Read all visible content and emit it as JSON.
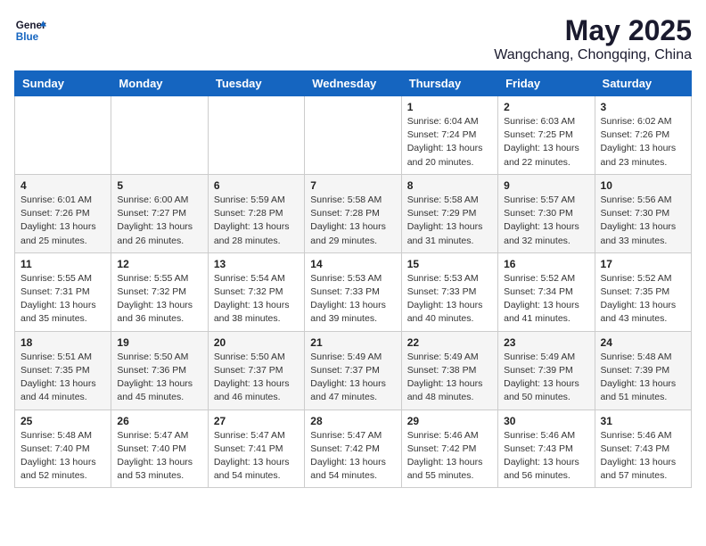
{
  "logo": {
    "general": "General",
    "blue": "Blue"
  },
  "title": "May 2025",
  "subtitle": "Wangchang, Chongqing, China",
  "days_of_week": [
    "Sunday",
    "Monday",
    "Tuesday",
    "Wednesday",
    "Thursday",
    "Friday",
    "Saturday"
  ],
  "weeks": [
    [
      {
        "day": "",
        "info": ""
      },
      {
        "day": "",
        "info": ""
      },
      {
        "day": "",
        "info": ""
      },
      {
        "day": "",
        "info": ""
      },
      {
        "day": "1",
        "sunrise": "6:04 AM",
        "sunset": "7:24 PM",
        "daylight": "13 hours and 20 minutes."
      },
      {
        "day": "2",
        "sunrise": "6:03 AM",
        "sunset": "7:25 PM",
        "daylight": "13 hours and 22 minutes."
      },
      {
        "day": "3",
        "sunrise": "6:02 AM",
        "sunset": "7:26 PM",
        "daylight": "13 hours and 23 minutes."
      }
    ],
    [
      {
        "day": "4",
        "sunrise": "6:01 AM",
        "sunset": "7:26 PM",
        "daylight": "13 hours and 25 minutes."
      },
      {
        "day": "5",
        "sunrise": "6:00 AM",
        "sunset": "7:27 PM",
        "daylight": "13 hours and 26 minutes."
      },
      {
        "day": "6",
        "sunrise": "5:59 AM",
        "sunset": "7:28 PM",
        "daylight": "13 hours and 28 minutes."
      },
      {
        "day": "7",
        "sunrise": "5:58 AM",
        "sunset": "7:28 PM",
        "daylight": "13 hours and 29 minutes."
      },
      {
        "day": "8",
        "sunrise": "5:58 AM",
        "sunset": "7:29 PM",
        "daylight": "13 hours and 31 minutes."
      },
      {
        "day": "9",
        "sunrise": "5:57 AM",
        "sunset": "7:30 PM",
        "daylight": "13 hours and 32 minutes."
      },
      {
        "day": "10",
        "sunrise": "5:56 AM",
        "sunset": "7:30 PM",
        "daylight": "13 hours and 33 minutes."
      }
    ],
    [
      {
        "day": "11",
        "sunrise": "5:55 AM",
        "sunset": "7:31 PM",
        "daylight": "13 hours and 35 minutes."
      },
      {
        "day": "12",
        "sunrise": "5:55 AM",
        "sunset": "7:32 PM",
        "daylight": "13 hours and 36 minutes."
      },
      {
        "day": "13",
        "sunrise": "5:54 AM",
        "sunset": "7:32 PM",
        "daylight": "13 hours and 38 minutes."
      },
      {
        "day": "14",
        "sunrise": "5:53 AM",
        "sunset": "7:33 PM",
        "daylight": "13 hours and 39 minutes."
      },
      {
        "day": "15",
        "sunrise": "5:53 AM",
        "sunset": "7:33 PM",
        "daylight": "13 hours and 40 minutes."
      },
      {
        "day": "16",
        "sunrise": "5:52 AM",
        "sunset": "7:34 PM",
        "daylight": "13 hours and 41 minutes."
      },
      {
        "day": "17",
        "sunrise": "5:52 AM",
        "sunset": "7:35 PM",
        "daylight": "13 hours and 43 minutes."
      }
    ],
    [
      {
        "day": "18",
        "sunrise": "5:51 AM",
        "sunset": "7:35 PM",
        "daylight": "13 hours and 44 minutes."
      },
      {
        "day": "19",
        "sunrise": "5:50 AM",
        "sunset": "7:36 PM",
        "daylight": "13 hours and 45 minutes."
      },
      {
        "day": "20",
        "sunrise": "5:50 AM",
        "sunset": "7:37 PM",
        "daylight": "13 hours and 46 minutes."
      },
      {
        "day": "21",
        "sunrise": "5:49 AM",
        "sunset": "7:37 PM",
        "daylight": "13 hours and 47 minutes."
      },
      {
        "day": "22",
        "sunrise": "5:49 AM",
        "sunset": "7:38 PM",
        "daylight": "13 hours and 48 minutes."
      },
      {
        "day": "23",
        "sunrise": "5:49 AM",
        "sunset": "7:39 PM",
        "daylight": "13 hours and 50 minutes."
      },
      {
        "day": "24",
        "sunrise": "5:48 AM",
        "sunset": "7:39 PM",
        "daylight": "13 hours and 51 minutes."
      }
    ],
    [
      {
        "day": "25",
        "sunrise": "5:48 AM",
        "sunset": "7:40 PM",
        "daylight": "13 hours and 52 minutes."
      },
      {
        "day": "26",
        "sunrise": "5:47 AM",
        "sunset": "7:40 PM",
        "daylight": "13 hours and 53 minutes."
      },
      {
        "day": "27",
        "sunrise": "5:47 AM",
        "sunset": "7:41 PM",
        "daylight": "13 hours and 54 minutes."
      },
      {
        "day": "28",
        "sunrise": "5:47 AM",
        "sunset": "7:42 PM",
        "daylight": "13 hours and 54 minutes."
      },
      {
        "day": "29",
        "sunrise": "5:46 AM",
        "sunset": "7:42 PM",
        "daylight": "13 hours and 55 minutes."
      },
      {
        "day": "30",
        "sunrise": "5:46 AM",
        "sunset": "7:43 PM",
        "daylight": "13 hours and 56 minutes."
      },
      {
        "day": "31",
        "sunrise": "5:46 AM",
        "sunset": "7:43 PM",
        "daylight": "13 hours and 57 minutes."
      }
    ]
  ]
}
